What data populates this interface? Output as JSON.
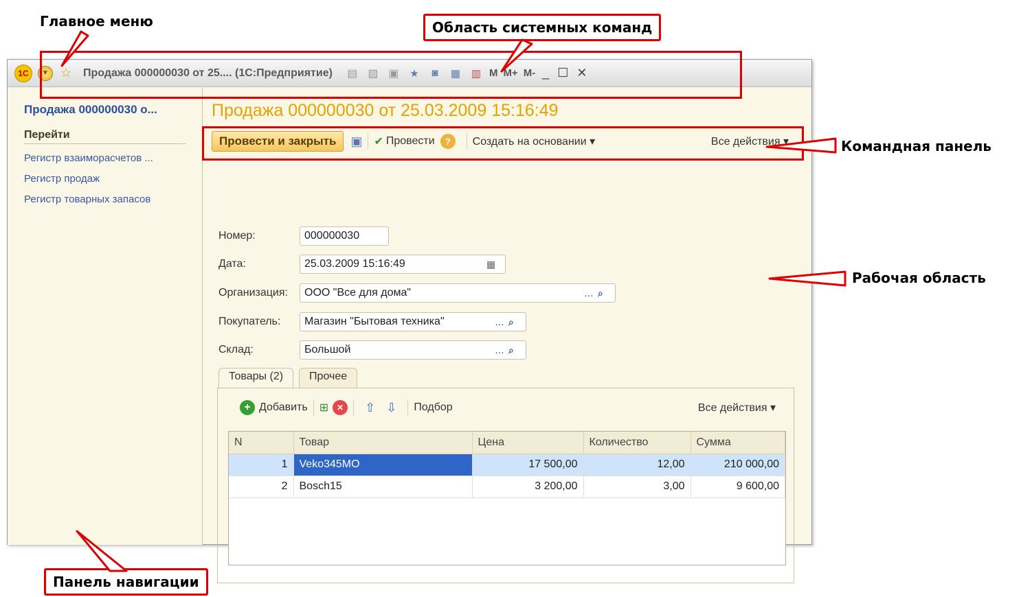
{
  "callouts": {
    "main_menu": "Главное меню",
    "system_commands": "Область системных команд",
    "command_panel": "Командная панель",
    "work_area": "Рабочая область",
    "nav_panel": "Панель навигации"
  },
  "titlebar": {
    "title": "Продажа 000000030 от 25....  (1С:Предприятие)",
    "m": "M",
    "mplus": "M+",
    "mminus": "M-"
  },
  "nav": {
    "title": "Продажа 000000030 о...",
    "section": "Перейти",
    "links": [
      "Регистр взаиморасчетов ...",
      "Регистр продаж",
      "Регистр товарных запасов"
    ]
  },
  "form": {
    "title": "Продажа 000000030 от 25.03.2009 15:16:49",
    "commands": {
      "post_close": "Провести и закрыть",
      "post": "Провести",
      "create_based": "Создать на основании ▾",
      "all_actions": "Все действия ▾"
    },
    "fields": {
      "number_label": "Номер:",
      "number_value": "000000030",
      "date_label": "Дата:",
      "date_value": "25.03.2009 15:16:49",
      "org_label": "Организация:",
      "org_value": "ООО \"Все для дома\"",
      "buyer_label": "Покупатель:",
      "buyer_value": "Магазин \"Бытовая техника\"",
      "warehouse_label": "Склад:",
      "warehouse_value": "Большой"
    },
    "tabs": [
      "Товары (2)",
      "Прочее"
    ],
    "tab_toolbar": {
      "add": "Добавить",
      "pick": "Подбор",
      "all_actions": "Все действия ▾"
    },
    "table": {
      "headers": [
        "N",
        "Товар",
        "Цена",
        "Количество",
        "Сумма"
      ],
      "rows": [
        [
          "1",
          "Veko345MO",
          "17 500,00",
          "12,00",
          "210 000,00"
        ],
        [
          "2",
          "Bosch15",
          "3 200,00",
          "3,00",
          "9 600,00"
        ]
      ]
    }
  }
}
